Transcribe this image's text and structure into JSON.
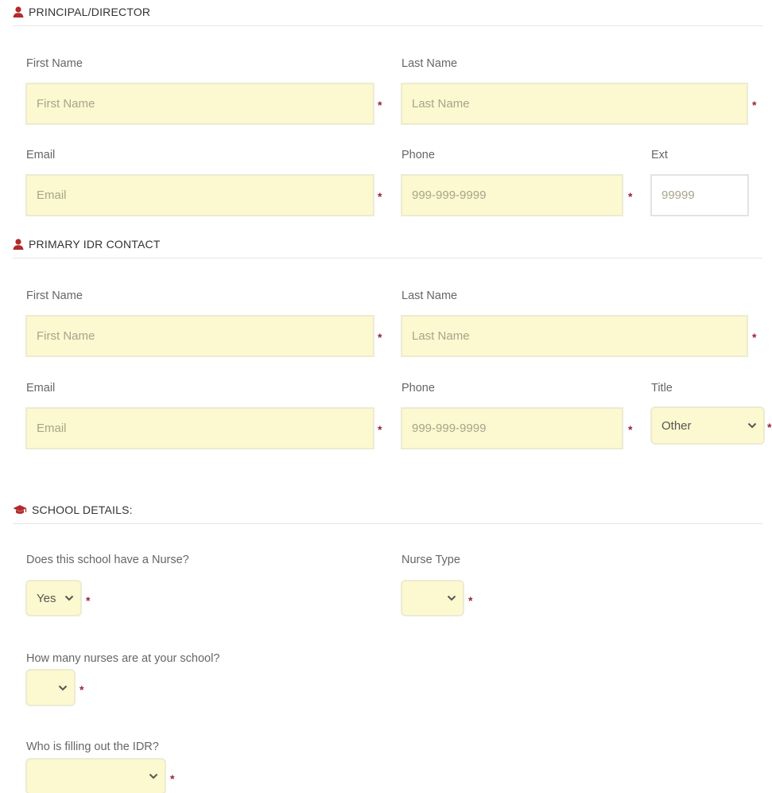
{
  "principal": {
    "heading": "PRINCIPAL/DIRECTOR",
    "first_name": {
      "label": "First Name",
      "placeholder": "First Name"
    },
    "last_name": {
      "label": "Last Name",
      "placeholder": "Last Name"
    },
    "email": {
      "label": "Email",
      "placeholder": "Email"
    },
    "phone": {
      "label": "Phone",
      "placeholder": "999-999-9999"
    },
    "ext": {
      "label": "Ext",
      "placeholder": "99999"
    }
  },
  "primary_contact": {
    "heading": "PRIMARY IDR CONTACT",
    "first_name": {
      "label": "First Name",
      "placeholder": "First Name"
    },
    "last_name": {
      "label": "Last Name",
      "placeholder": "Last Name"
    },
    "email": {
      "label": "Email",
      "placeholder": "Email"
    },
    "phone": {
      "label": "Phone",
      "placeholder": "999-999-9999"
    },
    "title": {
      "label": "Title",
      "value": "Other"
    }
  },
  "school_details": {
    "heading": "SCHOOL DETAILS:",
    "has_nurse": {
      "label": "Does this school have a Nurse?",
      "value": "Yes"
    },
    "nurse_type": {
      "label": "Nurse Type",
      "value": ""
    },
    "nurse_count": {
      "label": "How many nurses are at your school?",
      "value": ""
    },
    "filled_by": {
      "label": "Who is filling out the IDR?",
      "value": ""
    }
  },
  "required_marker": "*",
  "colors": {
    "accent": "#b22a2a",
    "required": "#9b2335",
    "input_bg": "#fcf8cf",
    "input_border": "#ecebd3"
  },
  "icons": {
    "person": "user-icon",
    "school": "graduation-cap-icon",
    "dropdown": "chevron-down-icon"
  }
}
